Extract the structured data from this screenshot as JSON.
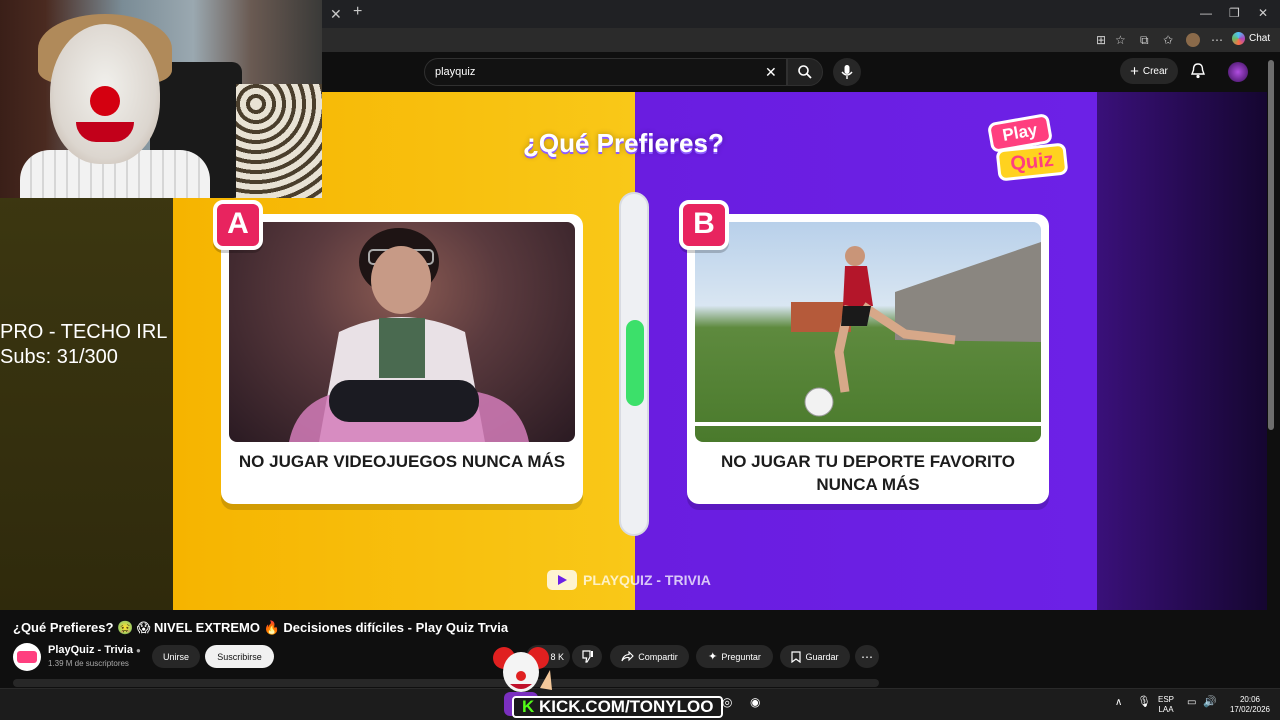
{
  "browser": {
    "chat_label": "Chat"
  },
  "youtube": {
    "search_query": "playquiz",
    "create_label": "Crear"
  },
  "video_frame": {
    "question": "¿Qué Prefieres?",
    "logo_line1": "Play",
    "logo_line2": "Quiz",
    "option_a": {
      "badge": "A",
      "caption": "NO JUGAR VIDEOJUEGOS NUNCA MÁS"
    },
    "option_b": {
      "badge": "B",
      "caption": "NO JUGAR TU DEPORTE FAVORITO NUNCA MÁS"
    },
    "meter_fraction_a": 0.52,
    "watermark": "PLAYQUIZ - TRIVIA"
  },
  "stream_overlay": {
    "line1": "PRO - TECHO IRL",
    "line2": "Subs: 31/300",
    "kick_url": "KICK.COM/TONYLOO"
  },
  "watch": {
    "title": "¿Qué Prefieres? 🤢 😱 NIVEL EXTREMO 🔥 Decisiones difíciles - Play Quiz Trvia",
    "channel_name": "PlayQuiz - Trivia",
    "subscribers": "1.39 M de suscriptores",
    "join_label": "Unirse",
    "subscribe_label": "Suscribirse",
    "likes_partial": "8 K",
    "share_label": "Compartir",
    "ask_label": "Preguntar",
    "save_label": "Guardar"
  },
  "taskbar": {
    "language": "ESP",
    "layout": "LAA",
    "time": "20:06",
    "date": "17/02/2026"
  },
  "colors": {
    "left_panel": "#f9c818",
    "right_panel": "#6c21e6",
    "badge": "#e8245f",
    "meter": "#3ce06a",
    "kick_green": "#53fc18"
  }
}
